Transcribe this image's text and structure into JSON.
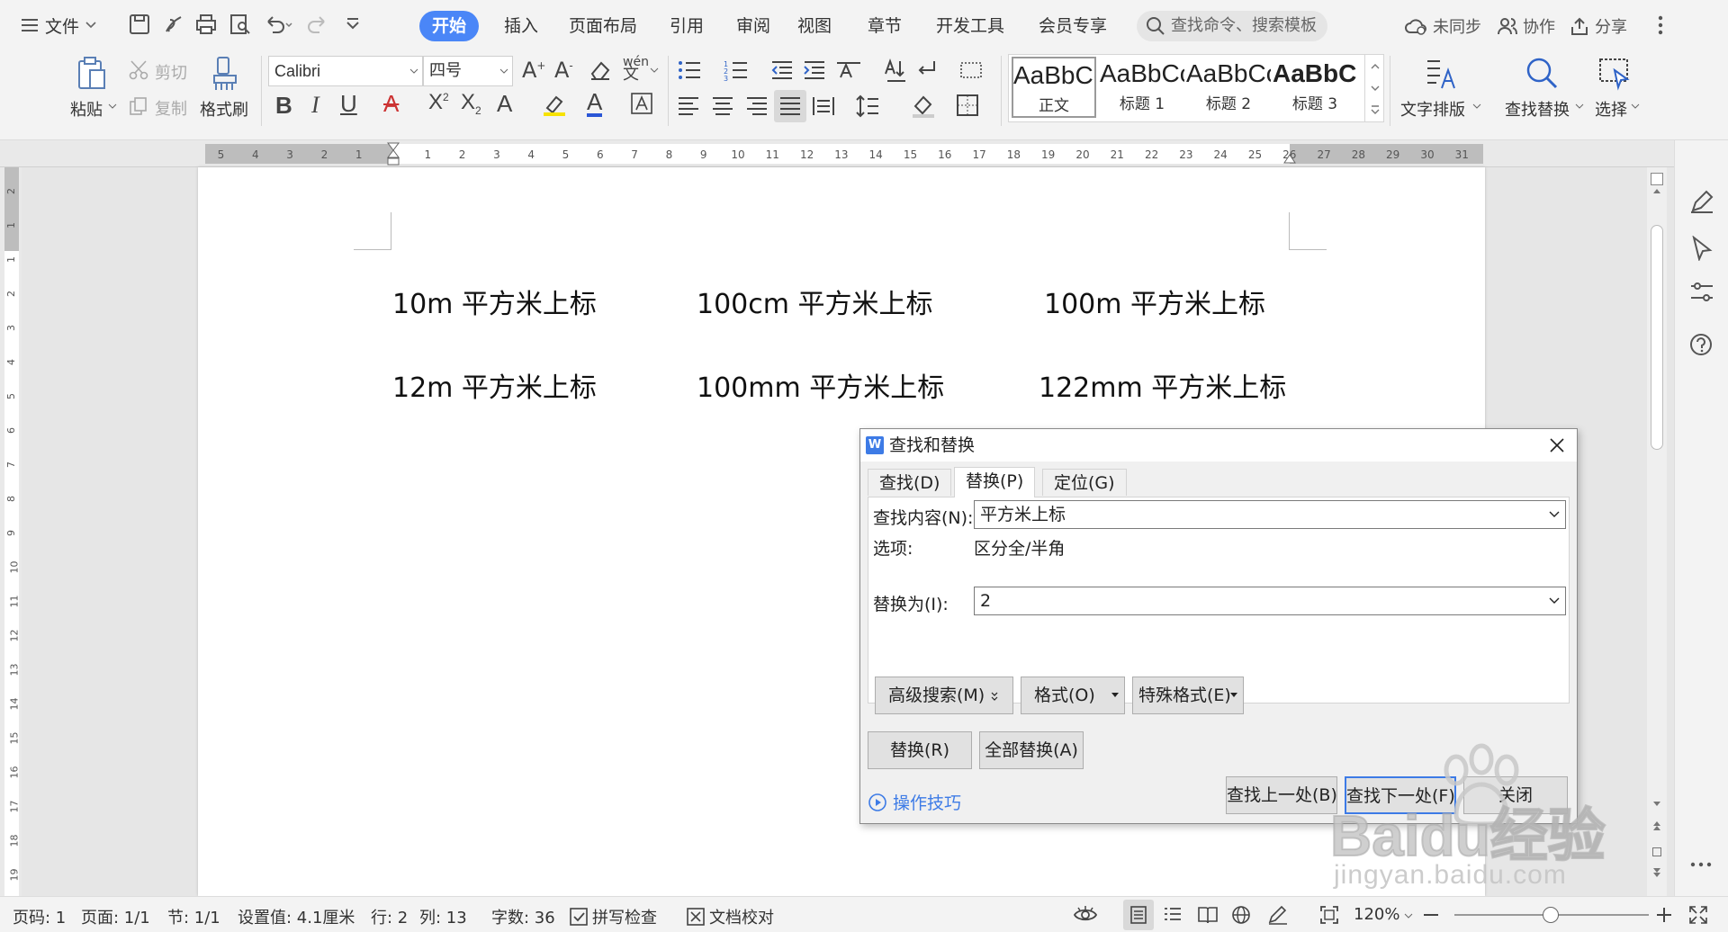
{
  "menubar": {
    "file_label": "文件",
    "tabs": [
      {
        "label": "开始",
        "active": true
      },
      {
        "label": "插入"
      },
      {
        "label": "页面布局"
      },
      {
        "label": "引用"
      },
      {
        "label": "审阅"
      },
      {
        "label": "视图"
      },
      {
        "label": "章节"
      },
      {
        "label": "开发工具"
      },
      {
        "label": "会员专享"
      }
    ],
    "search_placeholder": "查找命令、搜索模板",
    "sync_label": "未同步",
    "collab_label": "协作",
    "share_label": "分享",
    "accent_color": "#4a86f7"
  },
  "ribbon": {
    "paste_label": "粘贴",
    "cut_label": "剪切",
    "copy_label": "复制",
    "format_painter_label": "格式刷",
    "font_name": "Calibri",
    "font_size": "四号",
    "styles": [
      {
        "sample": "AaBbCcDd",
        "name": "正文"
      },
      {
        "sample": "AaBbCcDd",
        "name": "标题 1"
      },
      {
        "sample": "AaBbCcDd",
        "name": "标题 2"
      },
      {
        "sample": "AaBbCcDd",
        "name": "标题 3"
      }
    ],
    "text_layout_label": "文字排版",
    "find_replace_label": "查找替换",
    "select_label": "选择"
  },
  "ruler": {
    "h_ticks_left": [
      "5",
      "4",
      "3",
      "2",
      "1"
    ],
    "h_ticks_right": [
      "1",
      "2",
      "3",
      "4",
      "5",
      "6",
      "7",
      "8",
      "9",
      "10",
      "11",
      "12",
      "13",
      "14",
      "15",
      "16",
      "17",
      "18",
      "19",
      "20",
      "21",
      "22",
      "23",
      "24",
      "25",
      "26",
      "27",
      "28",
      "29",
      "30",
      "31"
    ],
    "v_ticks": [
      "2",
      "1",
      "1",
      "2",
      "3",
      "4",
      "5",
      "6",
      "7",
      "8",
      "9",
      "10",
      "11",
      "12",
      "13",
      "14",
      "15",
      "16",
      "17",
      "18",
      "19"
    ]
  },
  "document": {
    "row1": [
      "10m 平方米上标",
      "100cm 平方米上标",
      "100m 平方米上标"
    ],
    "row2": [
      "12m 平方米上标",
      "100mm 平方米上标",
      "122mm 平方米上标"
    ]
  },
  "dialog": {
    "title": "查找和替换",
    "tabs": [
      "查找(D)",
      "替换(P)",
      "定位(G)"
    ],
    "active_tab": "替换(P)",
    "find_label": "查找内容(N):",
    "find_value": "平方米上标",
    "options_label": "选项:",
    "options_value": "区分全/半角",
    "replace_label": "替换为(I):",
    "replace_value": "2",
    "advanced_search": "高级搜索(M)",
    "format_btn": "格式(O)",
    "special_btn": "特殊格式(E)",
    "replace_btn": "替换(R)",
    "replace_all_btn": "全部替换(A)",
    "tips_link": "操作技巧",
    "find_prev_btn": "查找上一处(B)",
    "find_next_btn": "查找下一处(F)",
    "close_btn": "关闭"
  },
  "status": {
    "page_no": "页码: 1",
    "pages": "页面: 1/1",
    "section": "节: 1/1",
    "setting": "设置值: 4.1厘米",
    "row": "行: 2",
    "col": "列: 13",
    "word_count": "字数: 36",
    "spell_check": "拼写检查",
    "doc_proof": "文档校对",
    "zoom": "120%"
  },
  "watermark": {
    "brand": "Baidu经验",
    "url": "jingyan.baidu.com"
  }
}
